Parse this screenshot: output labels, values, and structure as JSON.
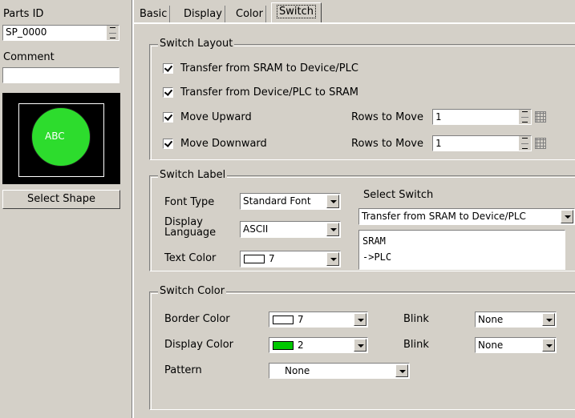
{
  "left": {
    "parts_id_label": "Parts ID",
    "parts_id_value": "SP_0000",
    "comment_label": "Comment",
    "comment_value": "",
    "preview_text": "ABC",
    "select_shape_label": "Select Shape"
  },
  "tabs": [
    "Basic",
    "Display",
    "Color",
    "Switch"
  ],
  "active_tab": "Switch",
  "switch_layout": {
    "legend": "Switch Layout",
    "transfer_sram_to_plc": "Transfer from SRAM to Device/PLC",
    "transfer_plc_to_sram": "Transfer from Device/PLC to SRAM",
    "move_upward": "Move Upward",
    "move_downward": "Move Downward",
    "rows_to_move_label": "Rows to Move",
    "rows_up_value": "1",
    "rows_down_value": "1"
  },
  "switch_label": {
    "legend": "Switch Label",
    "font_type_label": "Font Type",
    "font_type_value": "Standard Font",
    "display_language_label": "Display Language",
    "display_language_value": "ASCII",
    "text_color_label": "Text Color",
    "text_color_value": "7",
    "select_switch_label": "Select Switch",
    "select_switch_value": "Transfer from SRAM to Device/PLC",
    "label_line1": "SRAM",
    "label_line2": "->PLC"
  },
  "switch_color": {
    "legend": "Switch Color",
    "border_color_label": "Border Color",
    "border_color_value": "7",
    "display_color_label": "Display Color",
    "display_color_value": "2",
    "blink_label": "Blink",
    "blink_border_value": "None",
    "blink_display_value": "None",
    "pattern_label": "Pattern",
    "pattern_value": "None"
  },
  "colors": {
    "background": "#d4d0c8",
    "preview_bg": "#000000",
    "circle_green": "#2ddc2d",
    "swatch_white": "#ffffff",
    "swatch_green": "#00c800"
  }
}
